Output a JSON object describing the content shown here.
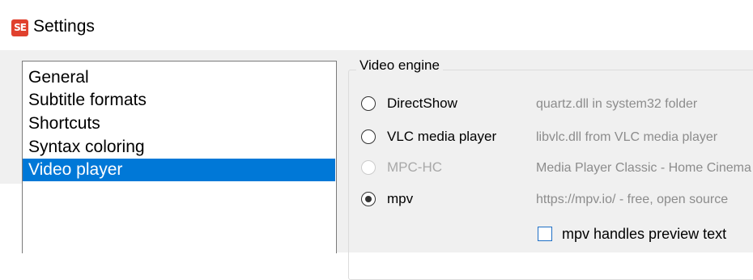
{
  "window": {
    "title": "Settings",
    "icon": "subtitle-edit-app-icon",
    "icon_text": "SE",
    "icon_color": "#e0412e"
  },
  "sidebar": {
    "items": [
      {
        "label": "General",
        "selected": false
      },
      {
        "label": "Subtitle formats",
        "selected": false
      },
      {
        "label": "Shortcuts",
        "selected": false
      },
      {
        "label": "Syntax coloring",
        "selected": false
      },
      {
        "label": "Video player",
        "selected": true
      }
    ],
    "selection_color": "#0078d7"
  },
  "video_engine": {
    "title": "Video engine",
    "options": [
      {
        "label": "DirectShow",
        "description": "quartz.dll in system32 folder",
        "checked": false,
        "enabled": true
      },
      {
        "label": "VLC media player",
        "description": "libvlc.dll from VLC media player",
        "checked": false,
        "enabled": true
      },
      {
        "label": "MPC-HC",
        "description": "Media Player Classic - Home Cinema",
        "checked": false,
        "enabled": false
      },
      {
        "label": "mpv",
        "description": "https://mpv.io/ - free, open source",
        "checked": true,
        "enabled": true
      }
    ],
    "mpv_checkbox": {
      "label": "mpv handles preview text",
      "checked": false
    }
  }
}
